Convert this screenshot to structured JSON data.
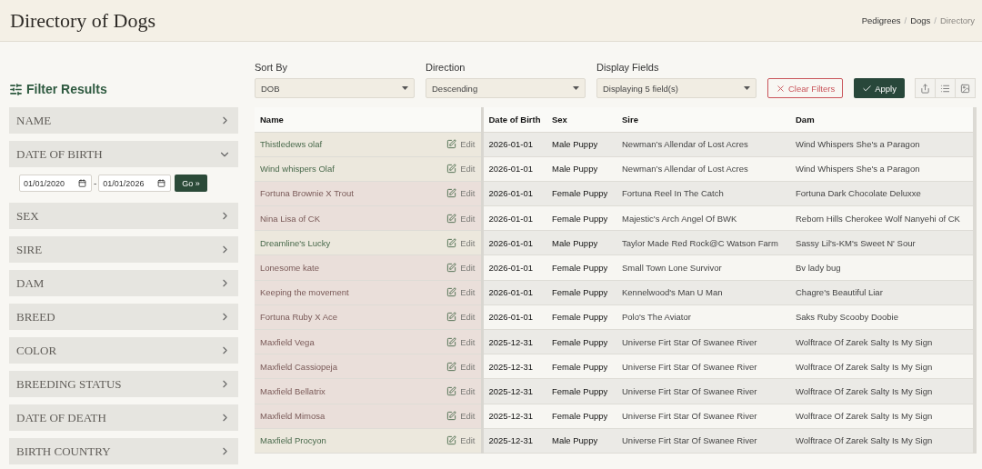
{
  "header": {
    "title": "Directory of Dogs",
    "breadcrumbs": [
      {
        "label": "Pedigrees",
        "current": false,
        "separator": "/"
      },
      {
        "label": "Dogs",
        "current": false,
        "separator": "/"
      },
      {
        "label": "Directory",
        "current": true
      }
    ]
  },
  "sidebar": {
    "title": "Filter Results",
    "filters": [
      {
        "label": "NAME",
        "expanded": false
      },
      {
        "label": "DATE OF BIRTH",
        "expanded": true,
        "range": {
          "from": "01/01/2020",
          "separator": "-",
          "to": "01/01/2026",
          "button": "Go »"
        }
      },
      {
        "label": "SEX",
        "expanded": false
      },
      {
        "label": "SIRE",
        "expanded": false
      },
      {
        "label": "DAM",
        "expanded": false
      },
      {
        "label": "BREED",
        "expanded": false
      },
      {
        "label": "COLOR",
        "expanded": false
      },
      {
        "label": "BREEDING STATUS",
        "expanded": false
      },
      {
        "label": "DATE OF DEATH",
        "expanded": false
      },
      {
        "label": "BIRTH COUNTRY",
        "expanded": false
      }
    ]
  },
  "controls": {
    "selects": [
      {
        "label": "Sort By",
        "value": "DOB"
      },
      {
        "label": "Direction",
        "value": "Descending"
      },
      {
        "label": "Display Fields",
        "value": "Displaying 5 field(s)"
      }
    ],
    "clear_button": "Clear Filters",
    "apply_button": "Apply"
  },
  "table": {
    "columns": [
      "Name",
      "Date of Birth",
      "Sex",
      "Sire",
      "Dam"
    ],
    "rows": [
      {
        "kind": "male",
        "name": "Thistledews olaf",
        "edit": "Edit",
        "dob": "2026-01-01",
        "sex": "Male Puppy",
        "sire": "Newman’s Allendar of Lost Acres",
        "dam": "Wind Whispers She's a Paragon"
      },
      {
        "kind": "male",
        "name": "Wind whispers Olaf",
        "edit": "Edit",
        "dob": "2026-01-01",
        "sex": "Male Puppy",
        "sire": "Newman’s Allendar of Lost Acres",
        "dam": "Wind Whispers She's a Paragon"
      },
      {
        "kind": "female",
        "name": "Fortuna Brownie X Trout",
        "edit": "Edit",
        "dob": "2026-01-01",
        "sex": "Female Puppy",
        "sire": "Fortuna Reel In The Catch",
        "dam": "Fortuna Dark Chocolate Deluxxe"
      },
      {
        "kind": "female",
        "name": "Nina Lisa of CK",
        "edit": "Edit",
        "dob": "2026-01-01",
        "sex": "Female Puppy",
        "sire": "Majestic's Arch Angel Of BWK",
        "dam": "Reborn Hills Cherokee Wolf Nanyehi of CK"
      },
      {
        "kind": "male",
        "name": "Dreamline's Lucky",
        "edit": "Edit",
        "dob": "2026-01-01",
        "sex": "Male Puppy",
        "sire": "Taylor Made Red Rock@C Watson Farm",
        "dam": "Sassy Lil's-KM's Sweet N' Sour"
      },
      {
        "kind": "female",
        "name": "Lonesome kate",
        "edit": "Edit",
        "dob": "2026-01-01",
        "sex": "Female Puppy",
        "sire": "Small Town Lone Survivor",
        "dam": "Bv lady bug"
      },
      {
        "kind": "female",
        "name": "Keeping the movement",
        "edit": "Edit",
        "dob": "2026-01-01",
        "sex": "Female Puppy",
        "sire": "Kennelwood's Man U Man",
        "dam": "Chagre's Beautiful Liar"
      },
      {
        "kind": "female",
        "name": "Fortuna Ruby X Ace",
        "edit": "Edit",
        "dob": "2026-01-01",
        "sex": "Female Puppy",
        "sire": "Polo's The Aviator",
        "dam": "Saks Ruby Scooby Doobie"
      },
      {
        "kind": "female",
        "name": "Maxfield Vega",
        "edit": "Edit",
        "dob": "2025-12-31",
        "sex": "Female Puppy",
        "sire": "Universe Firt Star Of Swanee River",
        "dam": "Wolftrace Of Zarek Salty Is My Sign"
      },
      {
        "kind": "female",
        "name": "Maxfield Cassiopeja",
        "edit": "Edit",
        "dob": "2025-12-31",
        "sex": "Female Puppy",
        "sire": "Universe Firt Star Of Swanee River",
        "dam": "Wolftrace Of Zarek Salty Is My Sign"
      },
      {
        "kind": "female",
        "name": "Maxfield Bellatrix",
        "edit": "Edit",
        "dob": "2025-12-31",
        "sex": "Female Puppy",
        "sire": "Universe Firt Star Of Swanee River",
        "dam": "Wolftrace Of Zarek Salty Is My Sign"
      },
      {
        "kind": "female",
        "name": "Maxfield Mimosa",
        "edit": "Edit",
        "dob": "2025-12-31",
        "sex": "Female Puppy",
        "sire": "Universe Firt Star Of Swanee River",
        "dam": "Wolftrace Of Zarek Salty Is My Sign"
      },
      {
        "kind": "male",
        "name": "Maxfield Procyon",
        "edit": "Edit",
        "dob": "2025-12-31",
        "sex": "Male Puppy",
        "sire": "Universe Firt Star Of Swanee River",
        "dam": "Wolftrace Of Zarek Salty Is My Sign"
      }
    ]
  }
}
